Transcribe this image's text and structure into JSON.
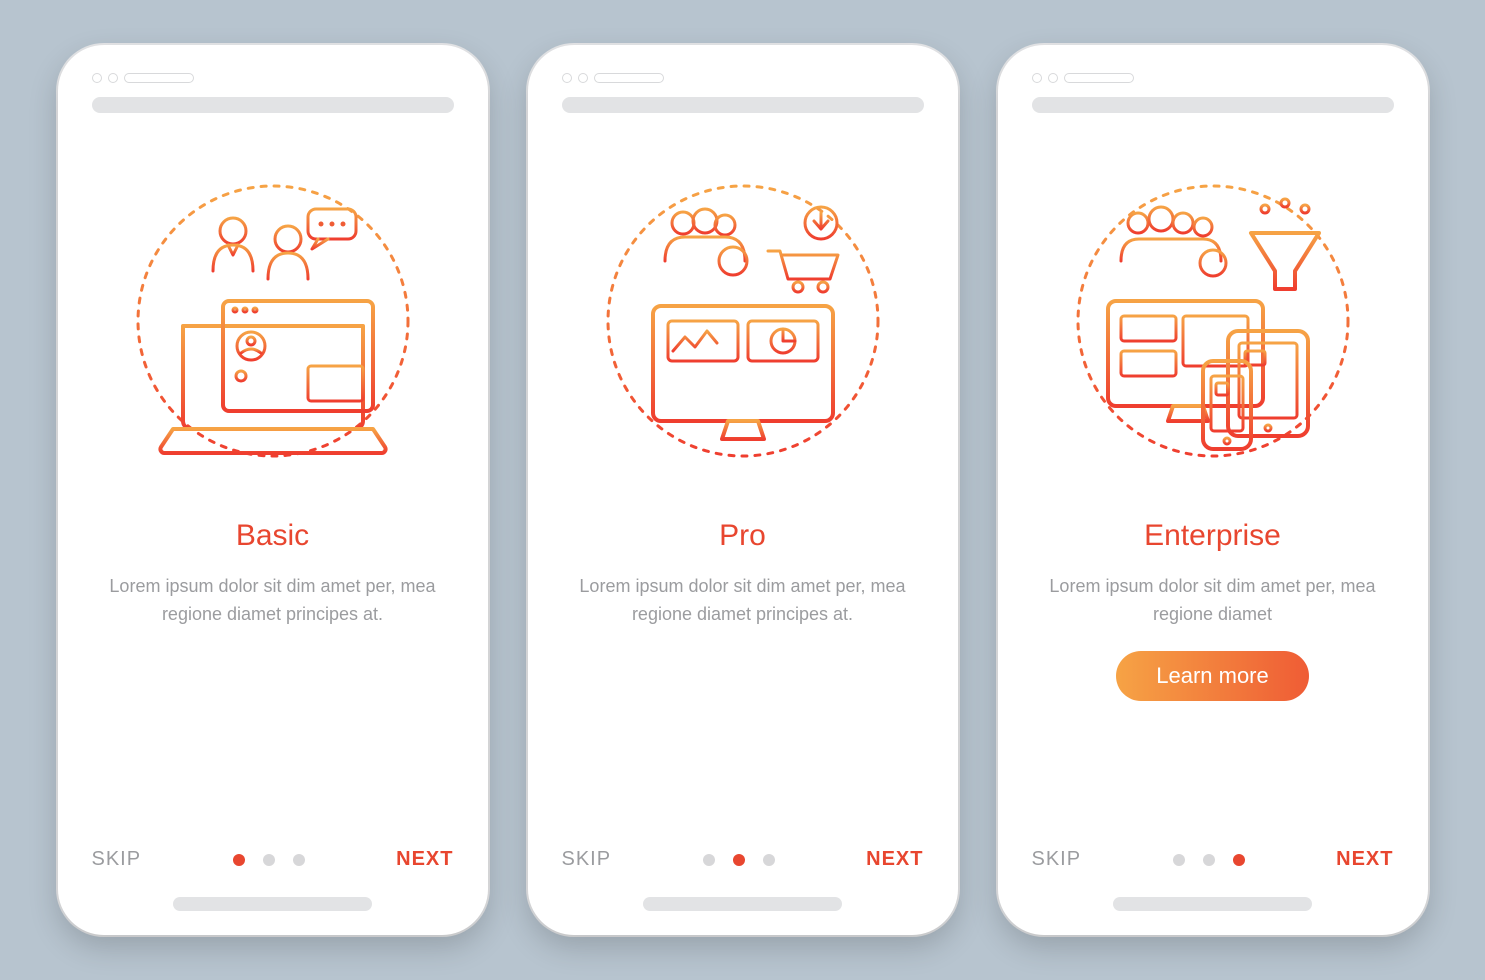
{
  "colors": {
    "accent_start": "#f6a345",
    "accent_end": "#ef3e2f",
    "text_muted": "#9b9c9f",
    "bg": "#b7c4cf"
  },
  "screens": [
    {
      "title": "Basic",
      "description": "Lorem ipsum dolor sit dim amet per, mea regione diamet principes at.",
      "skip_label": "SKIP",
      "next_label": "NEXT",
      "active_dot": 0,
      "show_cta": false,
      "icon": "basic"
    },
    {
      "title": "Pro",
      "description": "Lorem ipsum dolor sit dim amet per, mea regione diamet principes at.",
      "skip_label": "SKIP",
      "next_label": "NEXT",
      "active_dot": 1,
      "show_cta": false,
      "icon": "pro"
    },
    {
      "title": "Enterprise",
      "description": "Lorem ipsum dolor sit dim amet per, mea regione diamet",
      "skip_label": "SKIP",
      "next_label": "NEXT",
      "active_dot": 2,
      "show_cta": true,
      "cta_label": "Learn more",
      "icon": "enterprise"
    }
  ]
}
